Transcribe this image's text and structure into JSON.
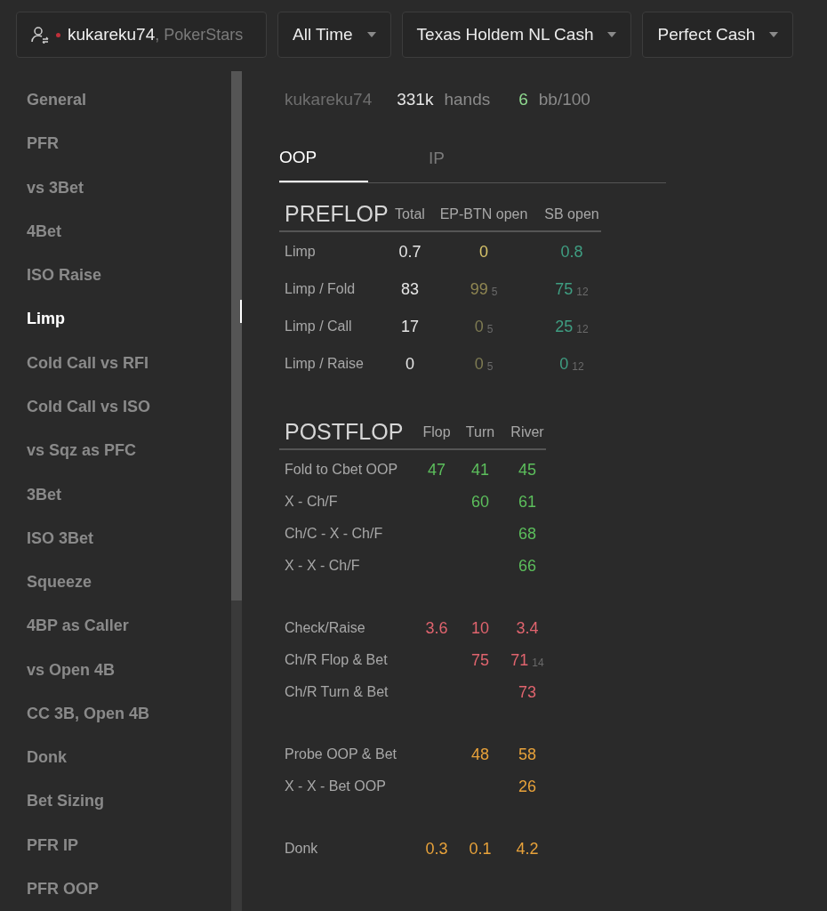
{
  "filters": {
    "player": {
      "name": "kukareku74",
      "site": ", PokerStars"
    },
    "dropdowns": [
      "All Time",
      "Texas Holdem NL Cash",
      "Perfect Cash"
    ]
  },
  "sidebar": {
    "items": [
      {
        "label": "General",
        "selected": false
      },
      {
        "label": "PFR",
        "selected": false
      },
      {
        "label": "vs 3Bet",
        "selected": false
      },
      {
        "label": "4Bet",
        "selected": false
      },
      {
        "label": "ISO Raise",
        "selected": false
      },
      {
        "label": "Limp",
        "selected": true
      },
      {
        "label": "Cold Call vs RFI",
        "selected": false
      },
      {
        "label": "Cold Call vs ISO",
        "selected": false
      },
      {
        "label": "vs Sqz as PFC",
        "selected": false
      },
      {
        "label": "3Bet",
        "selected": false
      },
      {
        "label": "ISO 3Bet",
        "selected": false
      },
      {
        "label": "Squeeze",
        "selected": false
      },
      {
        "label": "4BP as Caller",
        "selected": false
      },
      {
        "label": "vs Open 4B",
        "selected": false
      },
      {
        "label": "CC 3B, Open 4B",
        "selected": false
      },
      {
        "label": "Donk",
        "selected": false
      },
      {
        "label": "Bet Sizing",
        "selected": false
      },
      {
        "label": "PFR IP",
        "selected": false
      },
      {
        "label": "PFR OOP",
        "selected": false
      }
    ]
  },
  "summary": {
    "player": "kukareku74",
    "hands": "331k",
    "hands_label": "hands",
    "winrate": "6",
    "winrate_label": "bb/100"
  },
  "tabs": [
    {
      "label": "OOP",
      "selected": true
    },
    {
      "label": "IP",
      "selected": false
    }
  ],
  "preflop": {
    "title": "PREFLOP",
    "columns": [
      "Total",
      "EP-BTN open",
      "SB open"
    ],
    "rows": [
      {
        "label": "Limp",
        "cells": [
          {
            "value": "0.7",
            "color": "#e6e6e6"
          },
          {
            "value": "0",
            "color": "#d8c46a"
          },
          {
            "value": "0.8",
            "color": "#3f9e82"
          }
        ]
      },
      {
        "label": "Limp / Fold",
        "cells": [
          {
            "value": "83",
            "color": "#e6e6e6"
          },
          {
            "value": "99",
            "sample": "5",
            "color": "#8f8652"
          },
          {
            "value": "75",
            "sample": "12",
            "color": "#3f9e82"
          }
        ]
      },
      {
        "label": "Limp / Call",
        "cells": [
          {
            "value": "17",
            "color": "#e6e6e6"
          },
          {
            "value": "0",
            "sample": "5",
            "color": "#7d7a52"
          },
          {
            "value": "25",
            "sample": "12",
            "color": "#3f9e82"
          }
        ]
      },
      {
        "label": "Limp / Raise",
        "cells": [
          {
            "value": "0",
            "color": "#e6e6e6"
          },
          {
            "value": "0",
            "sample": "5",
            "color": "#7d7a52"
          },
          {
            "value": "0",
            "sample": "12",
            "color": "#3f9e82"
          }
        ]
      }
    ]
  },
  "postflop": {
    "title": "POSTFLOP",
    "columns": [
      "Flop",
      "Turn",
      "River"
    ],
    "groups": [
      [
        {
          "label": "Fold to Cbet OOP",
          "cells": [
            {
              "value": "47",
              "color": "#5cbf5c"
            },
            {
              "value": "41",
              "color": "#5cbf5c"
            },
            {
              "value": "45",
              "color": "#5cbf5c"
            }
          ]
        },
        {
          "label": "X - Ch/F",
          "cells": [
            {
              "value": "60",
              "color": "#5cbf5c"
            },
            {
              "value": "61",
              "color": "#5cbf5c"
            }
          ]
        },
        {
          "label": "Ch/C - X - Ch/F",
          "cells": [
            {
              "value": "68",
              "color": "#5cbf5c"
            }
          ]
        },
        {
          "label": "X - X - Ch/F",
          "cells": [
            {
              "value": "66",
              "color": "#5cbf5c"
            }
          ]
        }
      ],
      [
        {
          "label": "Check/Raise",
          "cells": [
            {
              "value": "3.6",
              "color": "#e0646e"
            },
            {
              "value": "10",
              "color": "#e0646e"
            },
            {
              "value": "3.4",
              "color": "#e0646e"
            }
          ]
        },
        {
          "label": "Ch/R Flop & Bet",
          "cells": [
            {
              "value": "75",
              "color": "#e0646e"
            },
            {
              "value": "71",
              "sample": "14",
              "color": "#e0646e"
            }
          ]
        },
        {
          "label": "Ch/R Turn & Bet",
          "cells": [
            {
              "value": "73",
              "color": "#e0646e"
            }
          ]
        }
      ],
      [
        {
          "label": "Probe OOP & Bet",
          "cells": [
            {
              "value": "48",
              "color": "#e8a23a"
            },
            {
              "value": "58",
              "color": "#e8a23a"
            }
          ]
        },
        {
          "label": "X - X - Bet OOP",
          "cells": [
            {
              "value": "26",
              "color": "#e8a23a"
            }
          ]
        }
      ],
      [
        {
          "label": "Donk",
          "cells": [
            {
              "value": "0.3",
              "color": "#e8a23a"
            },
            {
              "value": "0.1",
              "color": "#e8a23a"
            },
            {
              "value": "4.2",
              "color": "#e8a23a"
            }
          ]
        }
      ]
    ]
  }
}
